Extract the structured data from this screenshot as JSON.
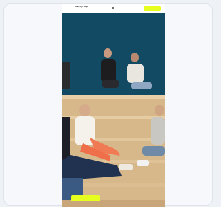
{
  "header": {
    "brand_name": "Step by Step",
    "brand_tagline": "",
    "cta_label": ""
  },
  "hero": {
    "image_description_icon": "team-photo",
    "cta_label": ""
  },
  "colors": {
    "accent": "#e6ff1f",
    "hero_wall": "#124a63",
    "bleacher_wood": "#d8b98d"
  }
}
